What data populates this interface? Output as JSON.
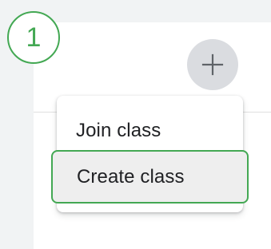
{
  "step": {
    "number": "1",
    "color": "#43a853"
  },
  "toolbar": {
    "add_icon": "plus-icon"
  },
  "menu": {
    "items": [
      {
        "label": "Join class"
      },
      {
        "label": "Create class",
        "highlighted": true
      }
    ]
  },
  "colors": {
    "highlight_border": "#43a853",
    "highlight_background": "#eeeeee",
    "text": "#202124",
    "button_background": "#dadce0"
  }
}
